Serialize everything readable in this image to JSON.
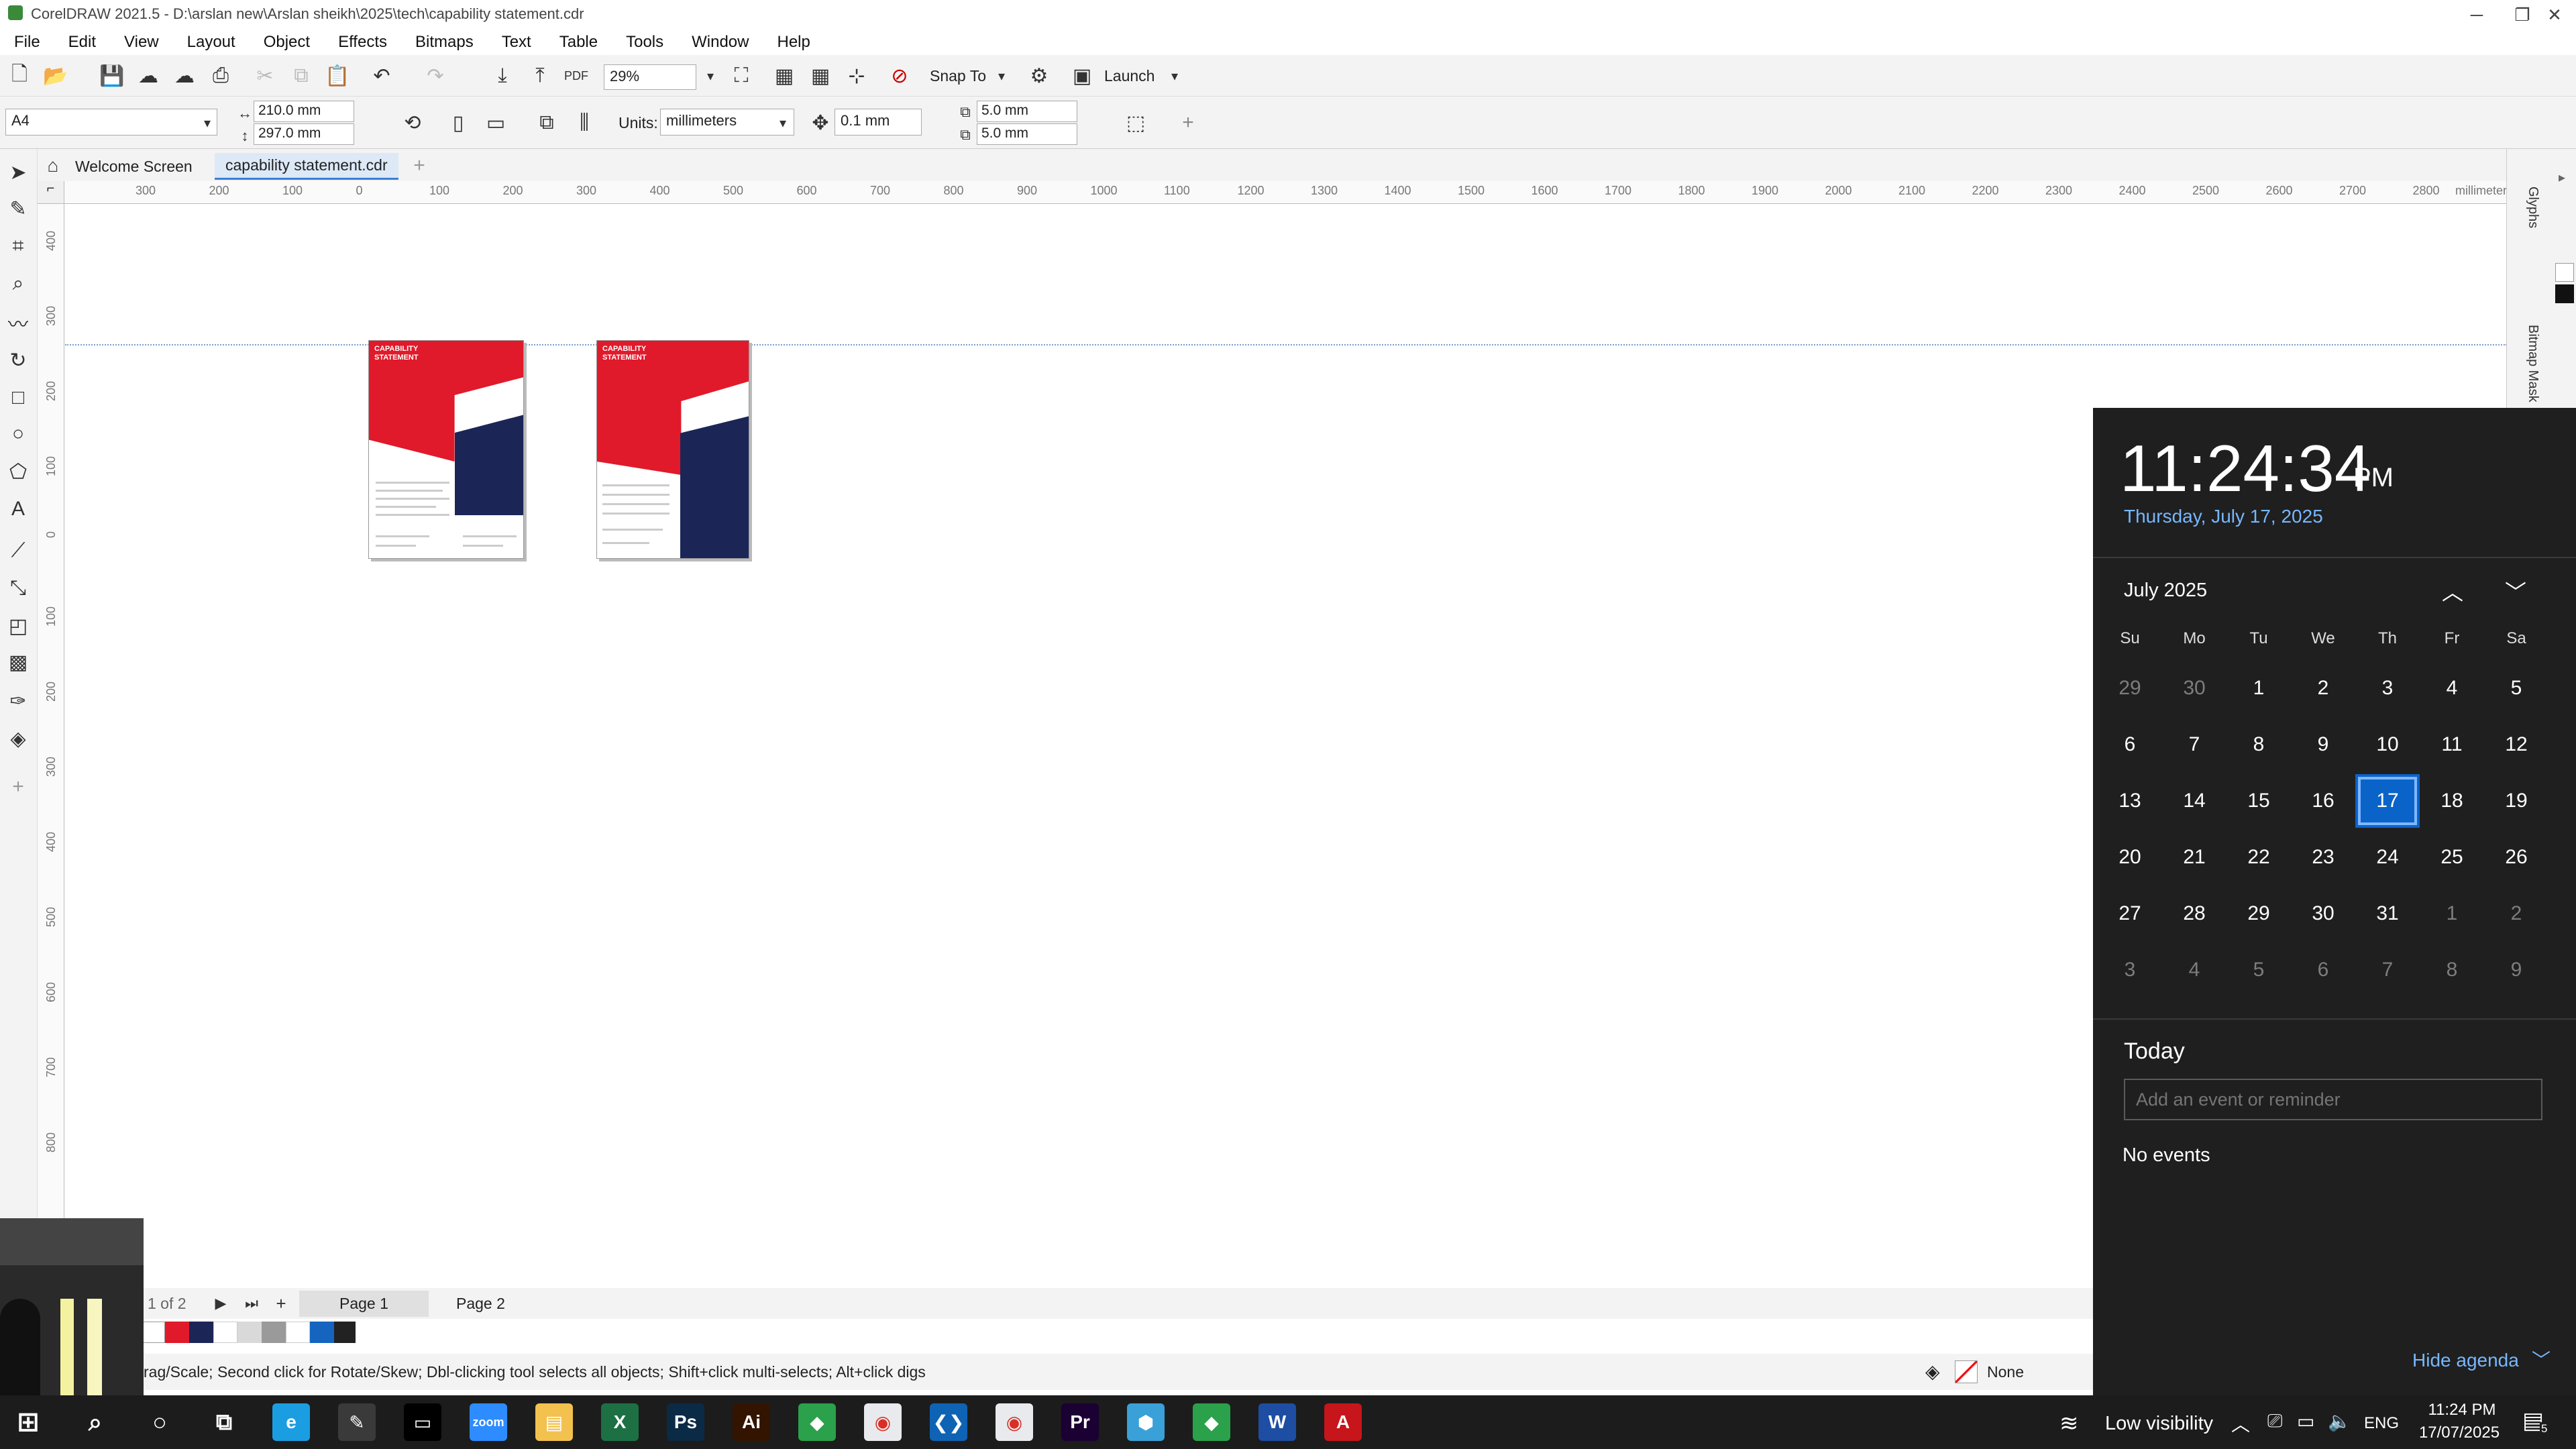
{
  "window": {
    "title": "CorelDRAW 2021.5 - D:\\arslan new\\Arslan sheikh\\2025\\tech\\capability statement.cdr",
    "minimize": "─",
    "restore": "❐",
    "close": "✕"
  },
  "menu": [
    "File",
    "Edit",
    "View",
    "Layout",
    "Object",
    "Effects",
    "Bitmaps",
    "Text",
    "Table",
    "Tools",
    "Window",
    "Help"
  ],
  "toolbar": {
    "zoom": "29%",
    "pdf_label": "PDF",
    "snap_to": "Snap To",
    "launch": "Launch"
  },
  "propertybar": {
    "page_size": "A4",
    "width": "210.0 mm",
    "height": "297.0 mm",
    "units_label": "Units:",
    "units_value": "millimeters",
    "nudge": "0.1 mm",
    "dup_x": "5.0 mm",
    "dup_y": "5.0 mm"
  },
  "doc_tabs": {
    "welcome": "Welcome Screen",
    "active": "capability statement.cdr"
  },
  "ruler": {
    "unit": "millimeters",
    "h_ticks": [
      "300",
      "200",
      "100",
      "0",
      "100",
      "200",
      "300",
      "400",
      "500",
      "600",
      "700",
      "800",
      "900",
      "1000",
      "1100",
      "1200",
      "1300",
      "1400",
      "1500",
      "1600",
      "1700",
      "1800",
      "1900",
      "2000",
      "2100",
      "2200",
      "2300",
      "2400",
      "2500",
      "2600",
      "2700",
      "2800"
    ],
    "v_ticks": [
      "400",
      "300",
      "200",
      "100",
      "0",
      "100",
      "200",
      "300",
      "400",
      "500",
      "600",
      "700",
      "800"
    ]
  },
  "pages_thumb": {
    "p1_title": "CAPABILITY STATEMENT",
    "p2_title": "CAPABILITY STATEMENT"
  },
  "right_dock": {
    "glyphs": "Glyphs",
    "bitmap_mask": "Bitmap Mask"
  },
  "page_nav": {
    "counter": "1 of 2",
    "page1": "Page 1",
    "page2": "Page 2"
  },
  "palette": [
    "#ffffff",
    "#e01a2b",
    "#1c2656",
    "#ffffff",
    "#d9d9d9",
    "#9a9a9a",
    "#ffffff",
    "#1565c0",
    "#222222"
  ],
  "status": {
    "hint": "rag/Scale; Second click for Rotate/Skew; Dbl-clicking tool selects all objects; Shift+click multi-selects; Alt+click digs",
    "fill": "None"
  },
  "clock": {
    "time": "11:24:34",
    "ampm": "PM",
    "date": "Thursday, July 17, 2025",
    "month": "July 2025",
    "weekdays": [
      "Su",
      "Mo",
      "Tu",
      "We",
      "Th",
      "Fr",
      "Sa"
    ],
    "weeks": [
      [
        {
          "d": "29",
          "dim": true
        },
        {
          "d": "30",
          "dim": true
        },
        {
          "d": "1"
        },
        {
          "d": "2"
        },
        {
          "d": "3"
        },
        {
          "d": "4"
        },
        {
          "d": "5"
        }
      ],
      [
        {
          "d": "6"
        },
        {
          "d": "7"
        },
        {
          "d": "8"
        },
        {
          "d": "9"
        },
        {
          "d": "10"
        },
        {
          "d": "11"
        },
        {
          "d": "12"
        }
      ],
      [
        {
          "d": "13"
        },
        {
          "d": "14"
        },
        {
          "d": "15"
        },
        {
          "d": "16"
        },
        {
          "d": "17",
          "today": true
        },
        {
          "d": "18"
        },
        {
          "d": "19"
        }
      ],
      [
        {
          "d": "20"
        },
        {
          "d": "21"
        },
        {
          "d": "22"
        },
        {
          "d": "23"
        },
        {
          "d": "24"
        },
        {
          "d": "25"
        },
        {
          "d": "26"
        }
      ],
      [
        {
          "d": "27"
        },
        {
          "d": "28"
        },
        {
          "d": "29"
        },
        {
          "d": "30"
        },
        {
          "d": "31"
        },
        {
          "d": "1",
          "dim": true
        },
        {
          "d": "2",
          "dim": true
        }
      ],
      [
        {
          "d": "3",
          "dim": true
        },
        {
          "d": "4",
          "dim": true
        },
        {
          "d": "5",
          "dim": true
        },
        {
          "d": "6",
          "dim": true
        },
        {
          "d": "7",
          "dim": true
        },
        {
          "d": "8",
          "dim": true
        },
        {
          "d": "9",
          "dim": true
        }
      ]
    ],
    "today_label": "Today",
    "event_placeholder": "Add an event or reminder",
    "no_events": "No events",
    "hide_agenda": "Hide agenda"
  },
  "taskbar": {
    "weather": "Low visibility",
    "lang": "ENG",
    "time": "11:24 PM",
    "date": "17/07/2025",
    "notif_count": "5",
    "apps": [
      {
        "name": "edge",
        "glyph": "e",
        "color": "#1b9de2"
      },
      {
        "name": "pen",
        "glyph": "✎",
        "color": "#3a3a3a"
      },
      {
        "name": "terminal",
        "glyph": "▭",
        "color": "#000000"
      },
      {
        "name": "zoom",
        "glyph": "zoom",
        "color": "#2d8cff"
      },
      {
        "name": "explorer",
        "glyph": "▤",
        "color": "#f2c14e"
      },
      {
        "name": "excel",
        "glyph": "X",
        "color": "#1d7044"
      },
      {
        "name": "photoshop",
        "glyph": "Ps",
        "color": "#0b2a45"
      },
      {
        "name": "illustrator",
        "glyph": "Ai",
        "color": "#331400"
      },
      {
        "name": "coreldraw-green",
        "glyph": "◆",
        "color": "#2aa14a"
      },
      {
        "name": "chrome",
        "glyph": "◉",
        "color": "#e8eaed"
      },
      {
        "name": "vscode",
        "glyph": "❮❯",
        "color": "#0e63b5"
      },
      {
        "name": "chrome-2",
        "glyph": "◉",
        "color": "#e8eaed"
      },
      {
        "name": "premiere",
        "glyph": "Pr",
        "color": "#1a0033"
      },
      {
        "name": "app-blue",
        "glyph": "⬢",
        "color": "#3aa0d8"
      },
      {
        "name": "coreldraw",
        "glyph": "◆",
        "color": "#2aa14a"
      },
      {
        "name": "word",
        "glyph": "W",
        "color": "#1d4ea3"
      },
      {
        "name": "acrobat",
        "glyph": "A",
        "color": "#c6151b"
      }
    ]
  }
}
